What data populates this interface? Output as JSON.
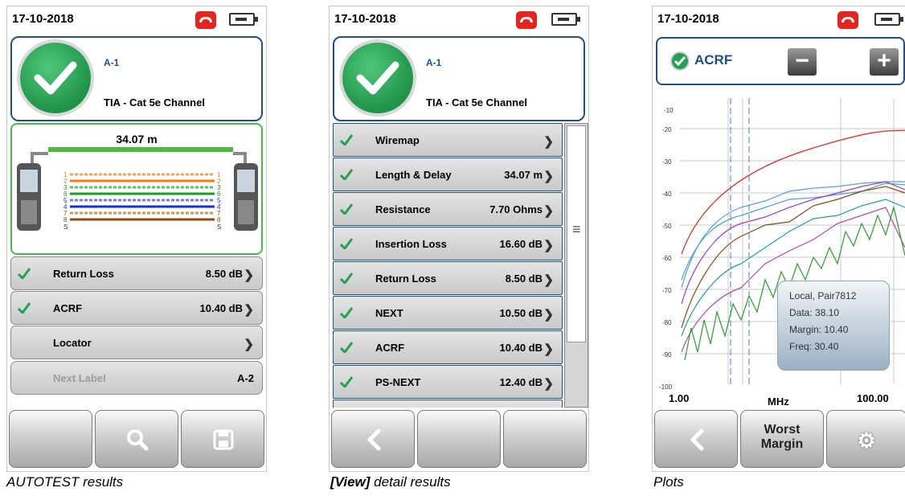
{
  "date": "17-10-2018",
  "screen1": {
    "test_id": "A-1",
    "standard": "TIA - Cat 5e Channel",
    "length": "34.07 m",
    "results": [
      {
        "label": "Return Loss",
        "value": "8.50 dB",
        "pass": true
      },
      {
        "label": "ACRF",
        "value": "10.40 dB",
        "pass": true
      },
      {
        "label": "Locator",
        "value": "",
        "pass": false
      }
    ],
    "next_label": "Next Label",
    "next_label_value": "A-2",
    "buttons": {
      "middle_icon": "search-icon",
      "right_icon": "save-icon"
    }
  },
  "screen2": {
    "test_id": "A-1",
    "standard": "TIA - Cat 5e Channel",
    "results": [
      {
        "label": "Wiremap",
        "value": ""
      },
      {
        "label": "Length & Delay",
        "value": "34.07 m"
      },
      {
        "label": "Resistance",
        "value": "7.70 Ohms"
      },
      {
        "label": "Insertion Loss",
        "value": "16.60 dB"
      },
      {
        "label": "Return Loss",
        "value": "8.50 dB"
      },
      {
        "label": "NEXT",
        "value": "10.50 dB"
      },
      {
        "label": "ACRF",
        "value": "10.40 dB"
      },
      {
        "label": "PS-NEXT",
        "value": "12.40 dB"
      }
    ],
    "buttons": {
      "left_icon": "back-icon"
    }
  },
  "screen3": {
    "plot_name": "ACRF",
    "y_ticks": [
      "-10",
      "-20",
      "-30",
      "-40",
      "-50",
      "-60",
      "-70",
      "-80",
      "-90",
      "-100"
    ],
    "x_start": "1.00",
    "x_unit": "MHz",
    "x_end": "100.00",
    "tooltip": {
      "location": "Local, Pair7812",
      "data": "Data: 38.10",
      "margin": "Margin: 10.40",
      "freq": "Freq: 30.40"
    },
    "buttons": {
      "left_icon": "back-icon",
      "middle_label_1": "Worst",
      "middle_label_2": "Margin",
      "right_icon": "gear-icon"
    }
  },
  "captions": {
    "c1": "AUTOTEST results",
    "c2_bold": "[View]",
    "c2_rest": " detail results",
    "c3": "Plots"
  },
  "colors": {
    "pass_green": "#23a150",
    "header_blue": "#1e4f8f",
    "limit_red": "#e52420"
  }
}
